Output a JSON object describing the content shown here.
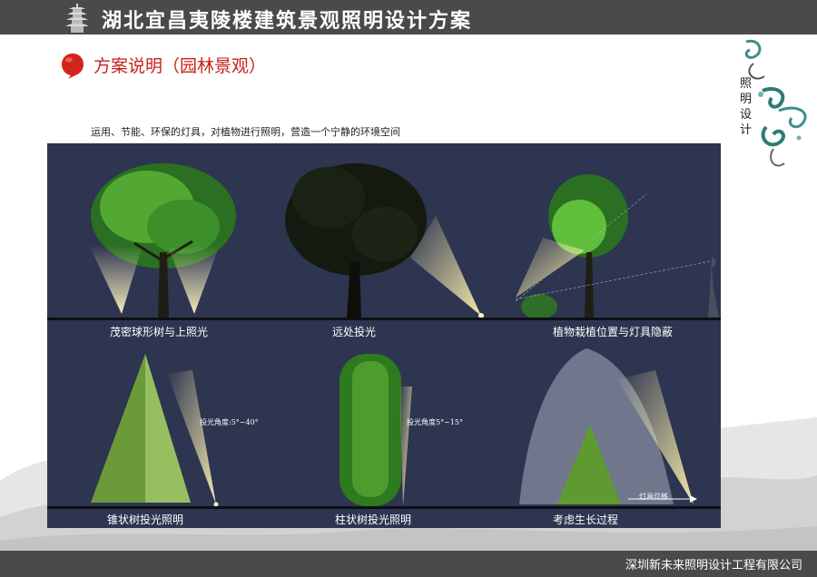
{
  "header": {
    "title": "湖北宜昌夷陵楼建筑景观照明设计方案",
    "logo_icon": "pagoda-icon"
  },
  "section": {
    "title": "方案说明（园林景观）",
    "marker_icon": "red-chat-bubble-icon"
  },
  "decoration": {
    "vertical_text": [
      "照",
      "明",
      "设",
      "计"
    ]
  },
  "intro": "运用、节能、环保的灯具，对植物进行照明，营造一个宁静的环境空间",
  "panels": [
    {
      "caption": "茂密球形树与上照光"
    },
    {
      "caption": "远处投光"
    },
    {
      "caption": "植物栽植位置与灯具隐蔽"
    },
    {
      "caption": "锥状树投光照明",
      "note": "投光角度:5°~40°"
    },
    {
      "caption": "柱状树投光照明",
      "note": "投光角度5°~15°"
    },
    {
      "caption": "考虑生长过程",
      "note": "灯具位移"
    }
  ],
  "footer": {
    "company": "深圳新未来照明设计工程有限公司"
  },
  "colors": {
    "header_bar": "#4a4a4a",
    "section_title": "#c8201a",
    "panel_bg": "#2e3550",
    "foliage": "#3f8a2a"
  }
}
